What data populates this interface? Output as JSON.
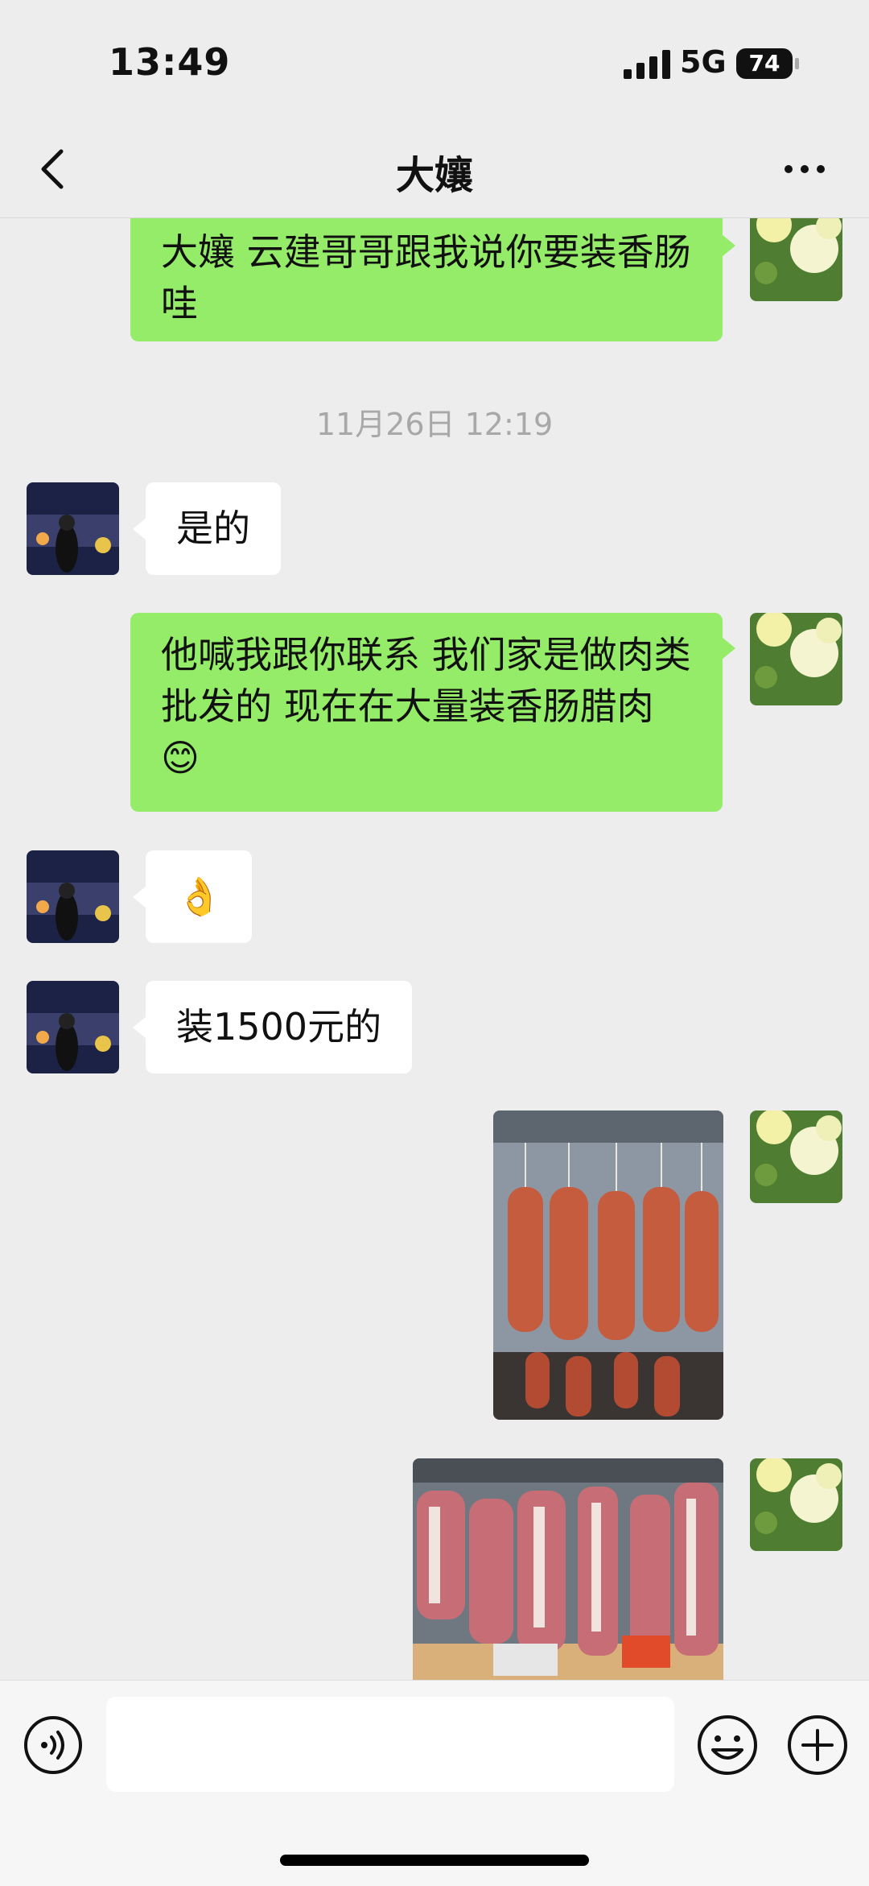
{
  "status_bar": {
    "time": "13:49",
    "network": "5G",
    "battery": "74"
  },
  "header": {
    "title": "大孃"
  },
  "messages": [
    {
      "text": "大孃 云建哥哥跟我说你要装香肠哇"
    },
    {
      "timestamp": "11月26日 12:19"
    },
    {
      "text": "是的"
    },
    {
      "text": "他喊我跟你联系 我们家是做肉类批发的 现在在大量装香肠腊肉😊"
    },
    {
      "text": "👌"
    },
    {
      "text": "装1500元的"
    }
  ],
  "colors": {
    "outgoing_bubble": "#95ec69",
    "incoming_bubble": "#ffffff",
    "background": "#ededed"
  },
  "icons": {
    "back": "chevron-left-icon",
    "more": "more-dots-icon",
    "voice": "voice-icon",
    "emoji": "emoji-icon",
    "plus": "plus-icon"
  }
}
